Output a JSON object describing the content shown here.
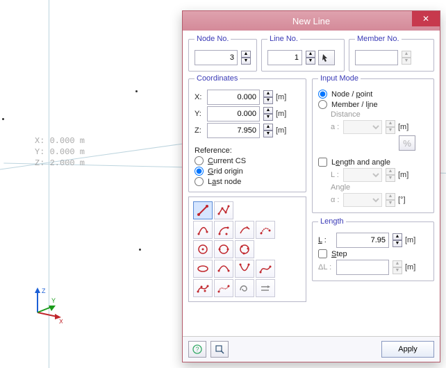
{
  "viewport": {
    "coord_overlay": "X: 0.000 m\nY: 0.000 m\nZ: 2.000 m",
    "triad": {
      "x_label": "X",
      "y_label": "Y",
      "z_label": "Z"
    }
  },
  "dialog": {
    "title": "New Line",
    "close_glyph": "✕",
    "top": {
      "node_no": {
        "legend": "Node No.",
        "value": "3"
      },
      "line_no": {
        "legend": "Line No.",
        "value": "1"
      },
      "member_no": {
        "legend": "Member No.",
        "value": ""
      }
    },
    "coordinates": {
      "legend": "Coordinates",
      "x_label": "X:",
      "x_value": "0.000",
      "x_unit": "[m]",
      "y_label": "Y:",
      "y_value": "0.000",
      "y_unit": "[m]",
      "z_label": "Z:",
      "z_value": "7.950",
      "z_unit": "[m]",
      "reference_label": "Reference:",
      "ref_current_cs": "Current CS",
      "ref_grid_origin": "Grid origin",
      "ref_last_node": "Last node"
    },
    "input_mode": {
      "legend": "Input Mode",
      "node_point": "Node / point",
      "member_line": "Member / line",
      "distance_label": "Distance",
      "a_label": "a :",
      "percent_btn": "%",
      "length_angle": "Length and angle",
      "l_label": "L :",
      "angle_label": "Angle",
      "alpha_label": "α :",
      "unit_m": "[m]",
      "unit_deg": "[°]"
    },
    "length": {
      "legend": "Length",
      "l_label": "L :",
      "l_value": "7.95",
      "unit_m": "[m]",
      "step": "Step",
      "dl_label": "ΔL :"
    },
    "footer": {
      "apply": "Apply"
    }
  }
}
